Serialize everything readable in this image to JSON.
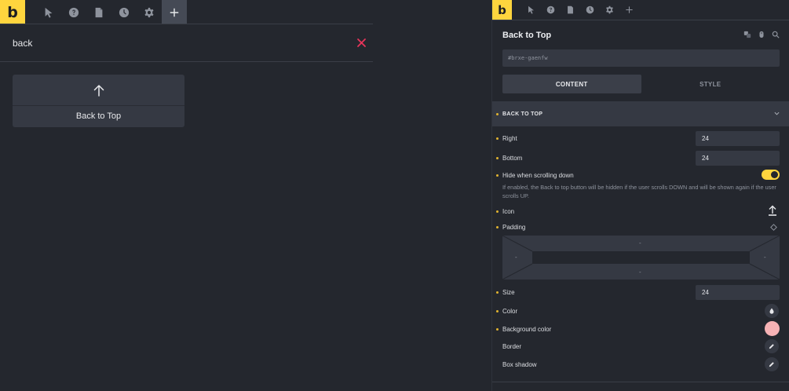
{
  "brand": {
    "logo_letter": "b",
    "accent": "#ffd53e"
  },
  "left_panel": {
    "toolbar": {
      "items": [
        "cursor-icon",
        "help-icon",
        "pages-icon",
        "history-icon",
        "settings-icon",
        "add-icon"
      ],
      "active": "add-icon"
    },
    "search": {
      "value": "back",
      "clear_color": "#e8345a"
    },
    "results": [
      {
        "label": "Back to Top",
        "icon": "arrow-up-icon"
      }
    ]
  },
  "right_panel": {
    "title": "Back to Top",
    "css_id": "#brxe-gaenfw",
    "tabs": {
      "content": "CONTENT",
      "style": "STYLE",
      "active": "content"
    },
    "group": {
      "label": "BACK TO TOP"
    },
    "controls": {
      "right": {
        "label": "Right",
        "value": "24"
      },
      "bottom": {
        "label": "Bottom",
        "value": "24"
      },
      "hide_scroll": {
        "label": "Hide when scrolling down",
        "enabled": true,
        "description": "If enabled, the Back to top button will be hidden if the user scrolls DOWN and will be shown again if the user scrolls UP."
      },
      "icon": {
        "label": "Icon",
        "icon": "upload-arrow-icon"
      },
      "padding": {
        "label": "Padding",
        "top": "-",
        "right": "-",
        "bottom": "-",
        "left": "-"
      },
      "size": {
        "label": "Size",
        "value": "24"
      },
      "color": {
        "label": "Color",
        "icon": "droplet-icon"
      },
      "background_color": {
        "label": "Background color",
        "swatch": "#f6b2b5"
      },
      "border": {
        "label": "Border",
        "icon": "pencil-icon"
      },
      "box_shadow": {
        "label": "Box shadow",
        "icon": "pencil-icon"
      }
    }
  }
}
